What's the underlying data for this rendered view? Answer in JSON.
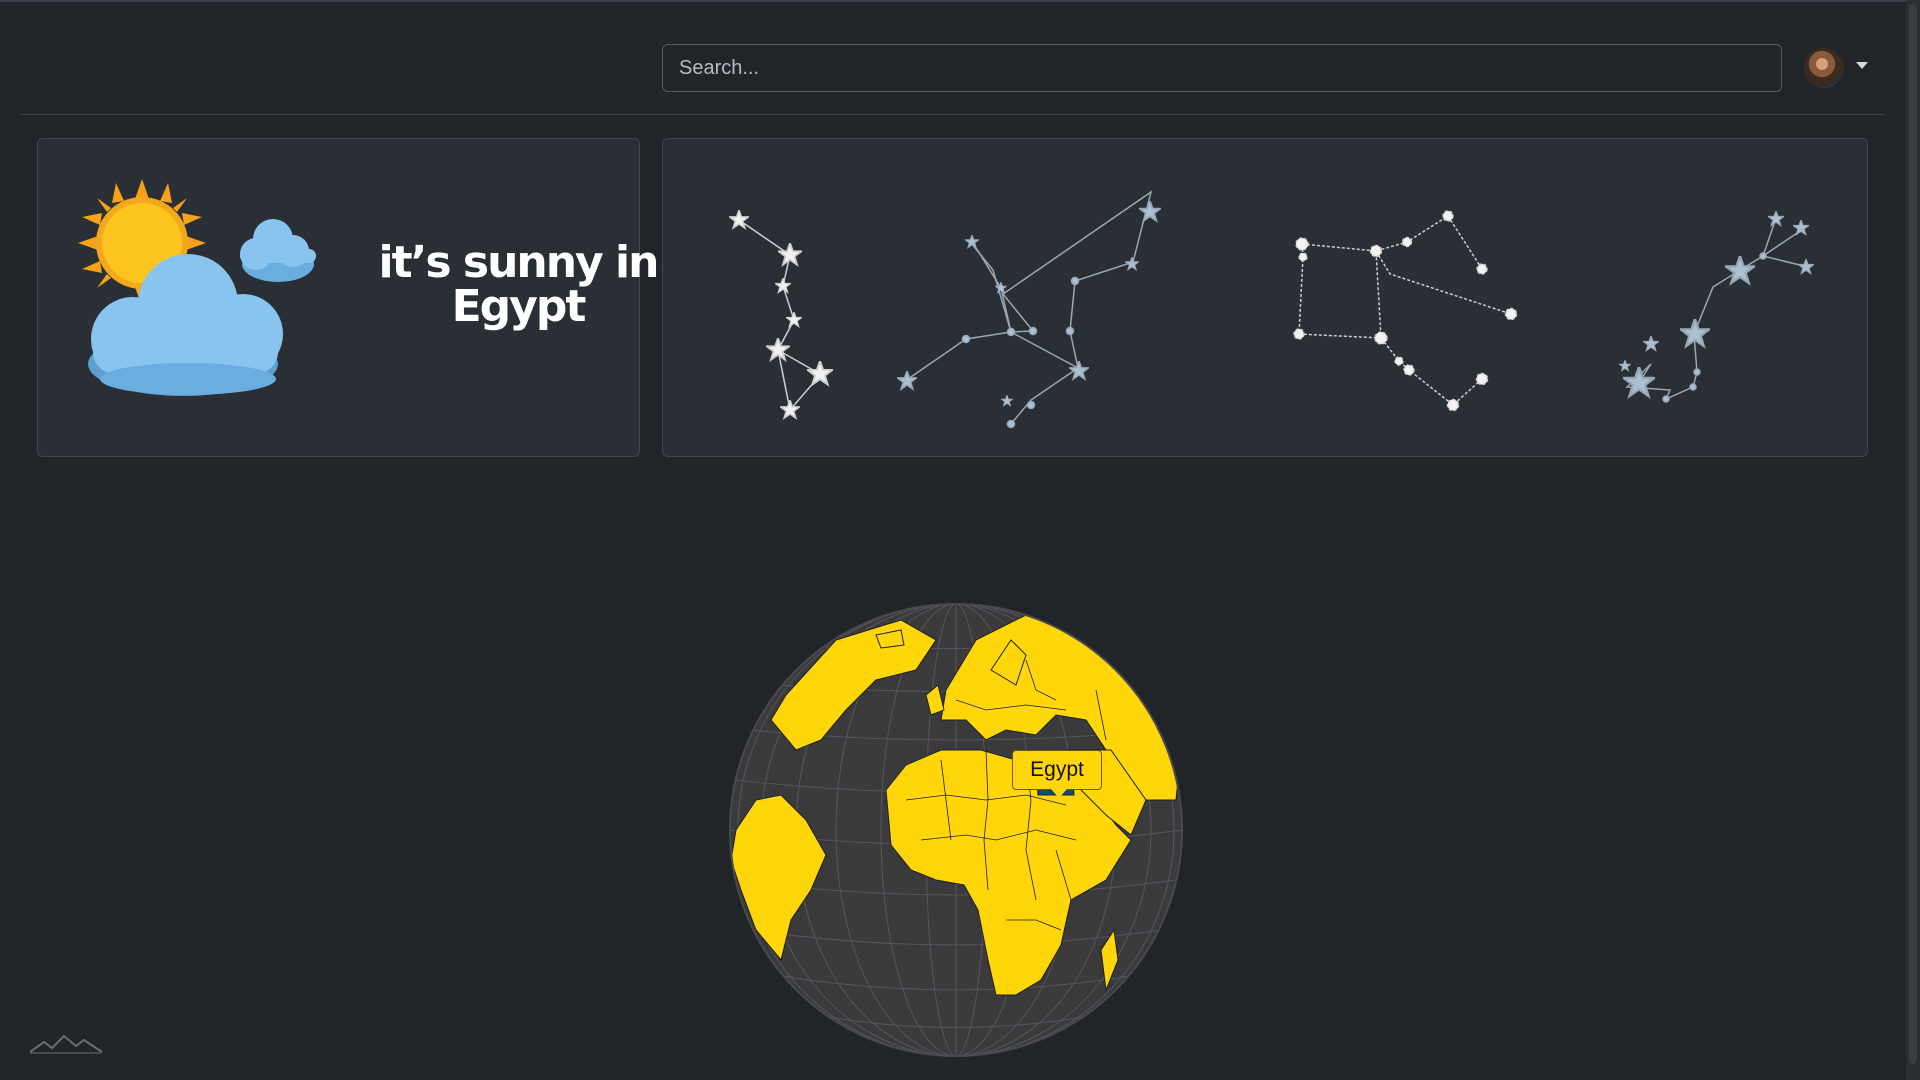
{
  "search": {
    "placeholder": "Search..."
  },
  "user": {
    "avatar": "user-avatar"
  },
  "weather_card": {
    "message": "it’s sunny in Egypt",
    "icons": [
      "sun-icon",
      "cloud-icon"
    ]
  },
  "constellations_card": {
    "icons": [
      "constellation-1-icon",
      "constellation-2-icon",
      "constellation-3-icon",
      "constellation-4-icon"
    ]
  },
  "globe": {
    "highlighted_country": "Egypt",
    "land_color": "#ffd60a",
    "ocean_color": "#3a3a3c",
    "highlight_color": "#0d4d7a"
  },
  "footer": {
    "logo": "mountain-logo-icon"
  }
}
